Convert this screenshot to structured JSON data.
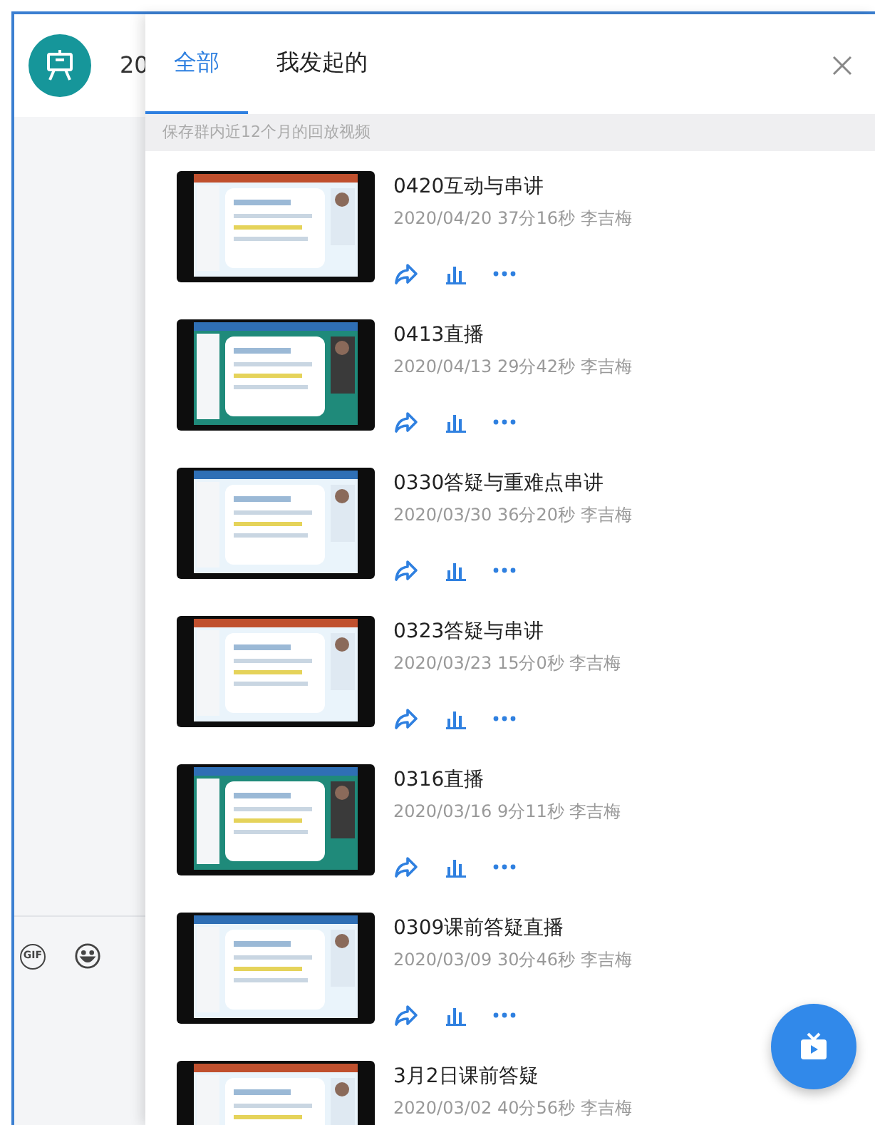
{
  "chat": {
    "header_text": "20",
    "toolbar": [
      "GIF"
    ]
  },
  "drawer": {
    "tabs": [
      {
        "label": "全部",
        "selected": true
      },
      {
        "label": "我发起的",
        "selected": false
      }
    ],
    "notice": "保存群内近12个月的回放视频",
    "videos": [
      {
        "title": "0420互动与串讲",
        "meta": "2020/04/20 37分16秒 李吉梅",
        "kind": "picture"
      },
      {
        "title": "0413直播",
        "meta": "2020/04/13 29分42秒 李吉梅",
        "kind": "picture"
      },
      {
        "title": "0330答疑与重难点串讲",
        "meta": "2020/03/30 36分20秒 李吉梅",
        "kind": "picture"
      },
      {
        "title": "0323答疑与串讲",
        "meta": "2020/03/23 15分0秒 李吉梅",
        "kind": "picture"
      },
      {
        "title": "0316直播",
        "meta": "2020/03/16 9分11秒 李吉梅",
        "kind": "picture"
      },
      {
        "title": "0309课前答疑直播",
        "meta": "2020/03/09 30分46秒 李吉梅",
        "kind": "picture"
      },
      {
        "title": "3月2日课前答疑",
        "meta": "2020/03/02 40分56秒 李吉梅",
        "kind": "picture",
        "actions_cut": true
      }
    ]
  }
}
